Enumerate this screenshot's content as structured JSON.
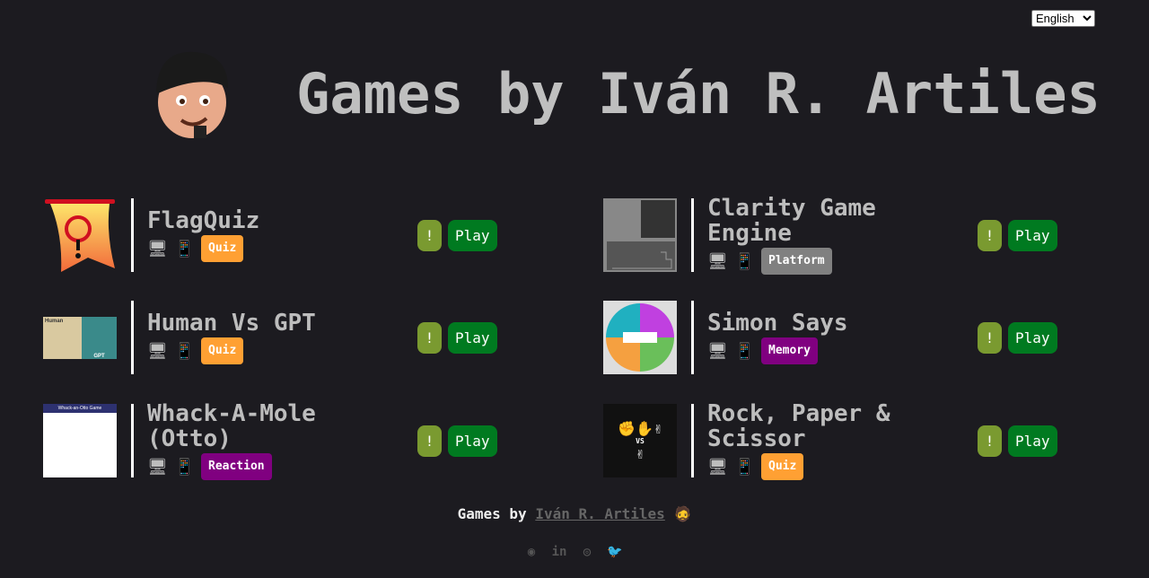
{
  "language": {
    "selected": "English"
  },
  "header": {
    "title": "Games by Iván R. Artiles"
  },
  "colors": {
    "background": "#1c1b20",
    "quiz": "#ffa033",
    "platform": "#808080",
    "memory": "#800080",
    "reaction": "#800080",
    "info_button": "#7a9a30",
    "play_button": "#007a20"
  },
  "games": [
    {
      "title": "FlagQuiz",
      "tag": "Quiz",
      "tag_color": "#ffa033",
      "info": "!",
      "play": "Play",
      "devices": [
        "desktop-icon",
        "mobile-icon"
      ]
    },
    {
      "title": "Clarity Game Engine",
      "tag": "Platform",
      "tag_color": "#808080",
      "info": "!",
      "play": "Play",
      "devices": [
        "desktop-icon",
        "mobile-icon"
      ]
    },
    {
      "title": "Human Vs GPT",
      "tag": "Quiz",
      "tag_color": "#ffa033",
      "info": "!",
      "play": "Play",
      "devices": [
        "desktop-icon",
        "mobile-icon"
      ]
    },
    {
      "title": "Simon Says",
      "tag": "Memory",
      "tag_color": "#800080",
      "info": "!",
      "play": "Play",
      "devices": [
        "desktop-icon",
        "mobile-icon"
      ]
    },
    {
      "title": "Whack-A-Mole (Otto)",
      "tag": "Reaction",
      "tag_color": "#800080",
      "info": "!",
      "play": "Play",
      "devices": [
        "desktop-icon",
        "mobile-icon"
      ]
    },
    {
      "title": "Rock, Paper & Scissor",
      "tag": "Quiz",
      "tag_color": "#ffa033",
      "info": "!",
      "play": "Play",
      "devices": [
        "desktop-icon",
        "mobile-icon"
      ]
    }
  ],
  "thumb_text": {
    "human": "Human",
    "gpt": "GPT",
    "whack": "Whack-an-Otto Game",
    "vs": "VS"
  },
  "footer": {
    "prefix": "Games by",
    "author": "Iván R. Artiles"
  },
  "social": [
    "github-icon",
    "linkedin-icon",
    "instagram-icon",
    "twitter-icon"
  ]
}
